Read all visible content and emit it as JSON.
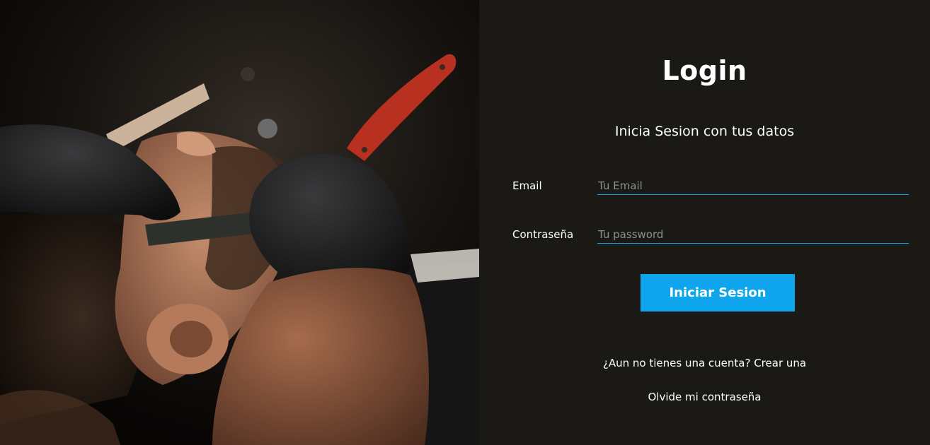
{
  "login": {
    "title": "Login",
    "subtitle": "Inicia Sesion con tus datos",
    "email": {
      "label": "Email",
      "placeholder": "Tu Email",
      "value": ""
    },
    "password": {
      "label": "Contraseña",
      "placeholder": "Tu password",
      "value": ""
    },
    "submit_label": "Iniciar Sesion",
    "create_account_link": "¿Aun no tienes una cuenta? Crear una",
    "forgot_password_link": "Olvide mi contraseña"
  },
  "colors": {
    "panel_background": "#1a1915",
    "accent": "#0ea5ec",
    "input_underline": "#18a2e8",
    "text": "#ffffff",
    "placeholder": "#8f8f8f"
  },
  "photo": {
    "subject": "barber-shave-photo"
  }
}
